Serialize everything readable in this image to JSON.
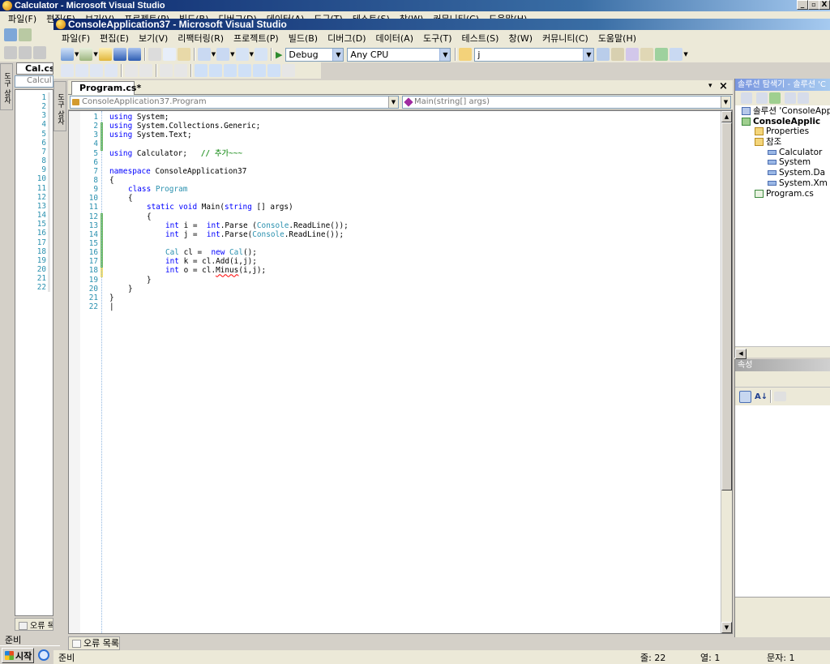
{
  "outer_window": {
    "title": "Calculator - Microsoft Visual Studio",
    "menu": [
      "파일(F)",
      "편집(E)",
      "보기(V)",
      "프로젝트(P)",
      "빌드(B)",
      "디버그(D)",
      "데이터(A)",
      "도구(T)",
      "테스트(S)",
      "창(W)",
      "커뮤니티(C)",
      "도움말(H)"
    ],
    "min_label": "_",
    "max_label": "▫",
    "close_label": "X",
    "tab_file": "Cal.cs",
    "tab_file2": "Calcul",
    "error_list_label": "오류 목",
    "status_ready": "준비",
    "toolbox_label": "도구 상자",
    "line_numbers": [
      "1",
      "2",
      "3",
      "4",
      "5",
      "6",
      "7",
      "8",
      "9",
      "10",
      "11",
      "12",
      "13",
      "14",
      "15",
      "16",
      "17",
      "18",
      "19",
      "20",
      "21",
      "22"
    ]
  },
  "taskbar": {
    "start_label": "시작"
  },
  "inner_window": {
    "title": "ConsoleApplication37 - Microsoft Visual Studio",
    "menu": [
      "파일(F)",
      "편집(E)",
      "보기(V)",
      "리팩터링(R)",
      "프로젝트(P)",
      "빌드(B)",
      "디버그(D)",
      "데이터(A)",
      "도구(T)",
      "테스트(S)",
      "창(W)",
      "커뮤니티(C)",
      "도움말(H)"
    ],
    "toolbar": {
      "config": "Debug",
      "platform": "Any CPU",
      "find_value": "j"
    },
    "toolbox_label": "도구 상자",
    "doc_tab": "Program.cs*",
    "nav_class": "ConsoleApplication37.Program",
    "nav_member": "Main(string[] args)",
    "pane_pin": "▾",
    "pane_close": "×"
  },
  "code_lines": [
    {
      "n": "1",
      "parts": [
        [
          "kw",
          "using"
        ],
        [
          "",
          "System;"
        ]
      ],
      "indent": 0
    },
    {
      "n": "2",
      "parts": [
        [
          "kw",
          "using"
        ],
        [
          "",
          "System.Collections.Generic;"
        ]
      ],
      "indent": 0
    },
    {
      "n": "3",
      "parts": [
        [
          "kw",
          "using"
        ],
        [
          "",
          "System.Text;"
        ]
      ],
      "indent": 0
    },
    {
      "n": "4",
      "parts": [],
      "indent": 0
    },
    {
      "n": "5",
      "parts": [
        [
          "kw",
          "using"
        ],
        [
          "",
          "Calculator;  "
        ],
        [
          "cm",
          "// 추가~~~"
        ]
      ],
      "indent": 0
    },
    {
      "n": "6",
      "parts": [],
      "indent": 0
    },
    {
      "n": "7",
      "parts": [
        [
          "kw",
          "namespace"
        ],
        [
          "",
          "ConsoleApplication37"
        ]
      ],
      "indent": 0
    },
    {
      "n": "8",
      "parts": [
        [
          "",
          "{"
        ]
      ],
      "indent": 0
    },
    {
      "n": "9",
      "parts": [
        [
          "kw",
          "class"
        ],
        [
          "ty",
          "Program"
        ]
      ],
      "indent": 1
    },
    {
      "n": "10",
      "parts": [
        [
          "",
          "{"
        ]
      ],
      "indent": 1
    },
    {
      "n": "11",
      "parts": [
        [
          "kw",
          "static"
        ],
        [
          "kw",
          "void"
        ],
        [
          "",
          "Main("
        ],
        [
          "kw",
          "string"
        ],
        [
          "",
          "[] args)"
        ]
      ],
      "indent": 2
    },
    {
      "n": "12",
      "parts": [
        [
          "",
          "{"
        ]
      ],
      "indent": 2
    },
    {
      "n": "13",
      "parts": [
        [
          "kw",
          "int"
        ],
        [
          "",
          "i = "
        ],
        [
          "kw",
          "int"
        ],
        [
          "",
          ".Parse ("
        ],
        [
          "ty",
          "Console"
        ],
        [
          "",
          ".ReadLine());"
        ]
      ],
      "indent": 3
    },
    {
      "n": "14",
      "parts": [
        [
          "kw",
          "int"
        ],
        [
          "",
          "j = "
        ],
        [
          "kw",
          "int"
        ],
        [
          "",
          ".Parse("
        ],
        [
          "ty",
          "Console"
        ],
        [
          "",
          ".ReadLine());"
        ]
      ],
      "indent": 3
    },
    {
      "n": "15",
      "parts": [],
      "indent": 3
    },
    {
      "n": "16",
      "parts": [
        [
          "ty",
          "Cal"
        ],
        [
          "",
          "cl = "
        ],
        [
          "kw",
          "new"
        ],
        [
          "ty",
          "Cal"
        ],
        [
          "",
          "();"
        ]
      ],
      "indent": 3
    },
    {
      "n": "17",
      "parts": [
        [
          "kw",
          "int"
        ],
        [
          "",
          "k = cl.Add(i,j);"
        ]
      ],
      "indent": 3
    },
    {
      "n": "18",
      "parts": [
        [
          "kw",
          "int"
        ],
        [
          "",
          "o = cl."
        ],
        [
          "err",
          "Minus"
        ],
        [
          "",
          "(i,j);"
        ]
      ],
      "indent": 3
    },
    {
      "n": "19",
      "parts": [
        [
          "",
          "}"
        ]
      ],
      "indent": 2
    },
    {
      "n": "20",
      "parts": [
        [
          "",
          "}"
        ]
      ],
      "indent": 1
    },
    {
      "n": "21",
      "parts": [
        [
          "",
          "}"
        ]
      ],
      "indent": 0
    },
    {
      "n": "22",
      "parts": [
        [
          "",
          "|"
        ]
      ],
      "indent": 0
    }
  ],
  "solution_explorer": {
    "header": "솔루션 탐색기 - 솔루션 'C",
    "items": [
      {
        "label": "솔루션 'ConsoleApp",
        "icon": "solution-icon",
        "depth": 0,
        "bold": false
      },
      {
        "label": "ConsoleApplic",
        "icon": "project-icon",
        "depth": 0,
        "bold": true
      },
      {
        "label": "Properties",
        "icon": "folder-icon",
        "depth": 1,
        "bold": false
      },
      {
        "label": "참조",
        "icon": "folder-icon",
        "depth": 1,
        "bold": false
      },
      {
        "label": "Calculator",
        "icon": "reference-icon",
        "depth": 2,
        "bold": false
      },
      {
        "label": "System",
        "icon": "reference-icon",
        "depth": 2,
        "bold": false
      },
      {
        "label": "System.Da",
        "icon": "reference-icon",
        "depth": 2,
        "bold": false
      },
      {
        "label": "System.Xm",
        "icon": "reference-icon",
        "depth": 2,
        "bold": false
      },
      {
        "label": "Program.cs",
        "icon": "cs-file-icon",
        "depth": 1,
        "bold": false
      }
    ]
  },
  "properties": {
    "header": "속성"
  },
  "error_list_tab": "오류 목록",
  "status": {
    "ready": "준비",
    "line": "줄: 22",
    "col": "열: 1",
    "char": "문자: 1"
  }
}
